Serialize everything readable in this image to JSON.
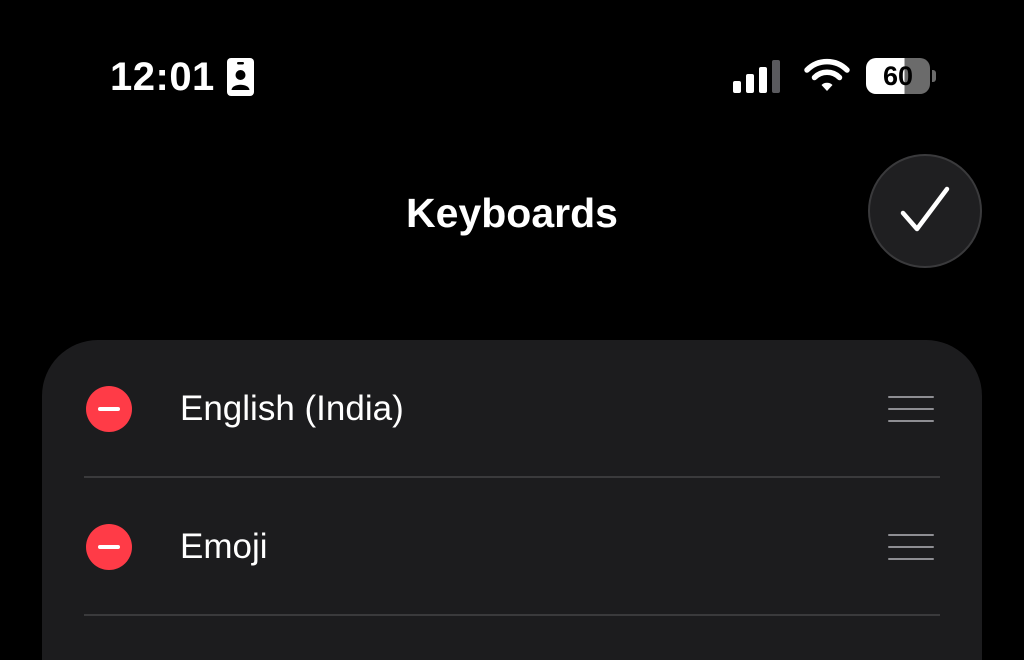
{
  "status_bar": {
    "time": "12:01",
    "battery_percent": "60",
    "battery_level": 0.6,
    "icons": [
      "contact-card-icon",
      "cellular-signal-icon",
      "wifi-icon",
      "battery-icon"
    ]
  },
  "header": {
    "title": "Keyboards",
    "done_icon": "checkmark-icon"
  },
  "keyboards": {
    "items": [
      {
        "label": "English (India)",
        "remove_icon": "minus-circle-icon",
        "reorder_icon": "reorder-handle-icon"
      },
      {
        "label": "Emoji",
        "remove_icon": "minus-circle-icon",
        "reorder_icon": "reorder-handle-icon"
      }
    ]
  },
  "colors": {
    "background": "#000000",
    "card": "#1c1c1e",
    "remove_red": "#ff3b47",
    "separator": "#3a3a3c",
    "handle": "#8e8e93"
  }
}
